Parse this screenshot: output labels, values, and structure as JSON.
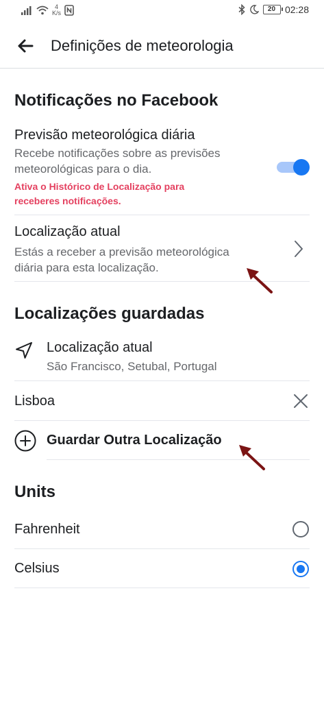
{
  "status_bar": {
    "net_speed_value": "4",
    "net_speed_unit": "K/s",
    "battery": "20",
    "time": "02:28"
  },
  "header": {
    "title": "Definições de meteorologia"
  },
  "notifications": {
    "section_title": "Notificações no Facebook",
    "daily_forecast": {
      "title": "Previsão meteorológica diária",
      "description_line1": "Recebe notificações sobre as previsões",
      "description_line2": "meteorológicas para o dia.",
      "warning_line1": "Ativa o Histórico de Localização para",
      "warning_line2": "receberes notificações.",
      "enabled": true
    },
    "current_location": {
      "title": "Localização atual",
      "description_line1": "Estás a receber a previsão meteorológica",
      "description_line2": "diária para esta localização."
    }
  },
  "saved_locations": {
    "section_title": "Localizações guardadas",
    "current": {
      "title": "Localização atual",
      "subtitle": "São Francisco, Setubal, Portugal"
    },
    "items": [
      {
        "label": "Lisboa"
      }
    ],
    "add_label": "Guardar Outra Localização"
  },
  "units": {
    "section_title": "Units",
    "options": [
      {
        "label": "Fahrenheit",
        "selected": false
      },
      {
        "label": "Celsius",
        "selected": true
      }
    ]
  },
  "colors": {
    "accent": "#1877f2",
    "warning": "#e4405f",
    "annotation_arrow": "#7b1414"
  }
}
